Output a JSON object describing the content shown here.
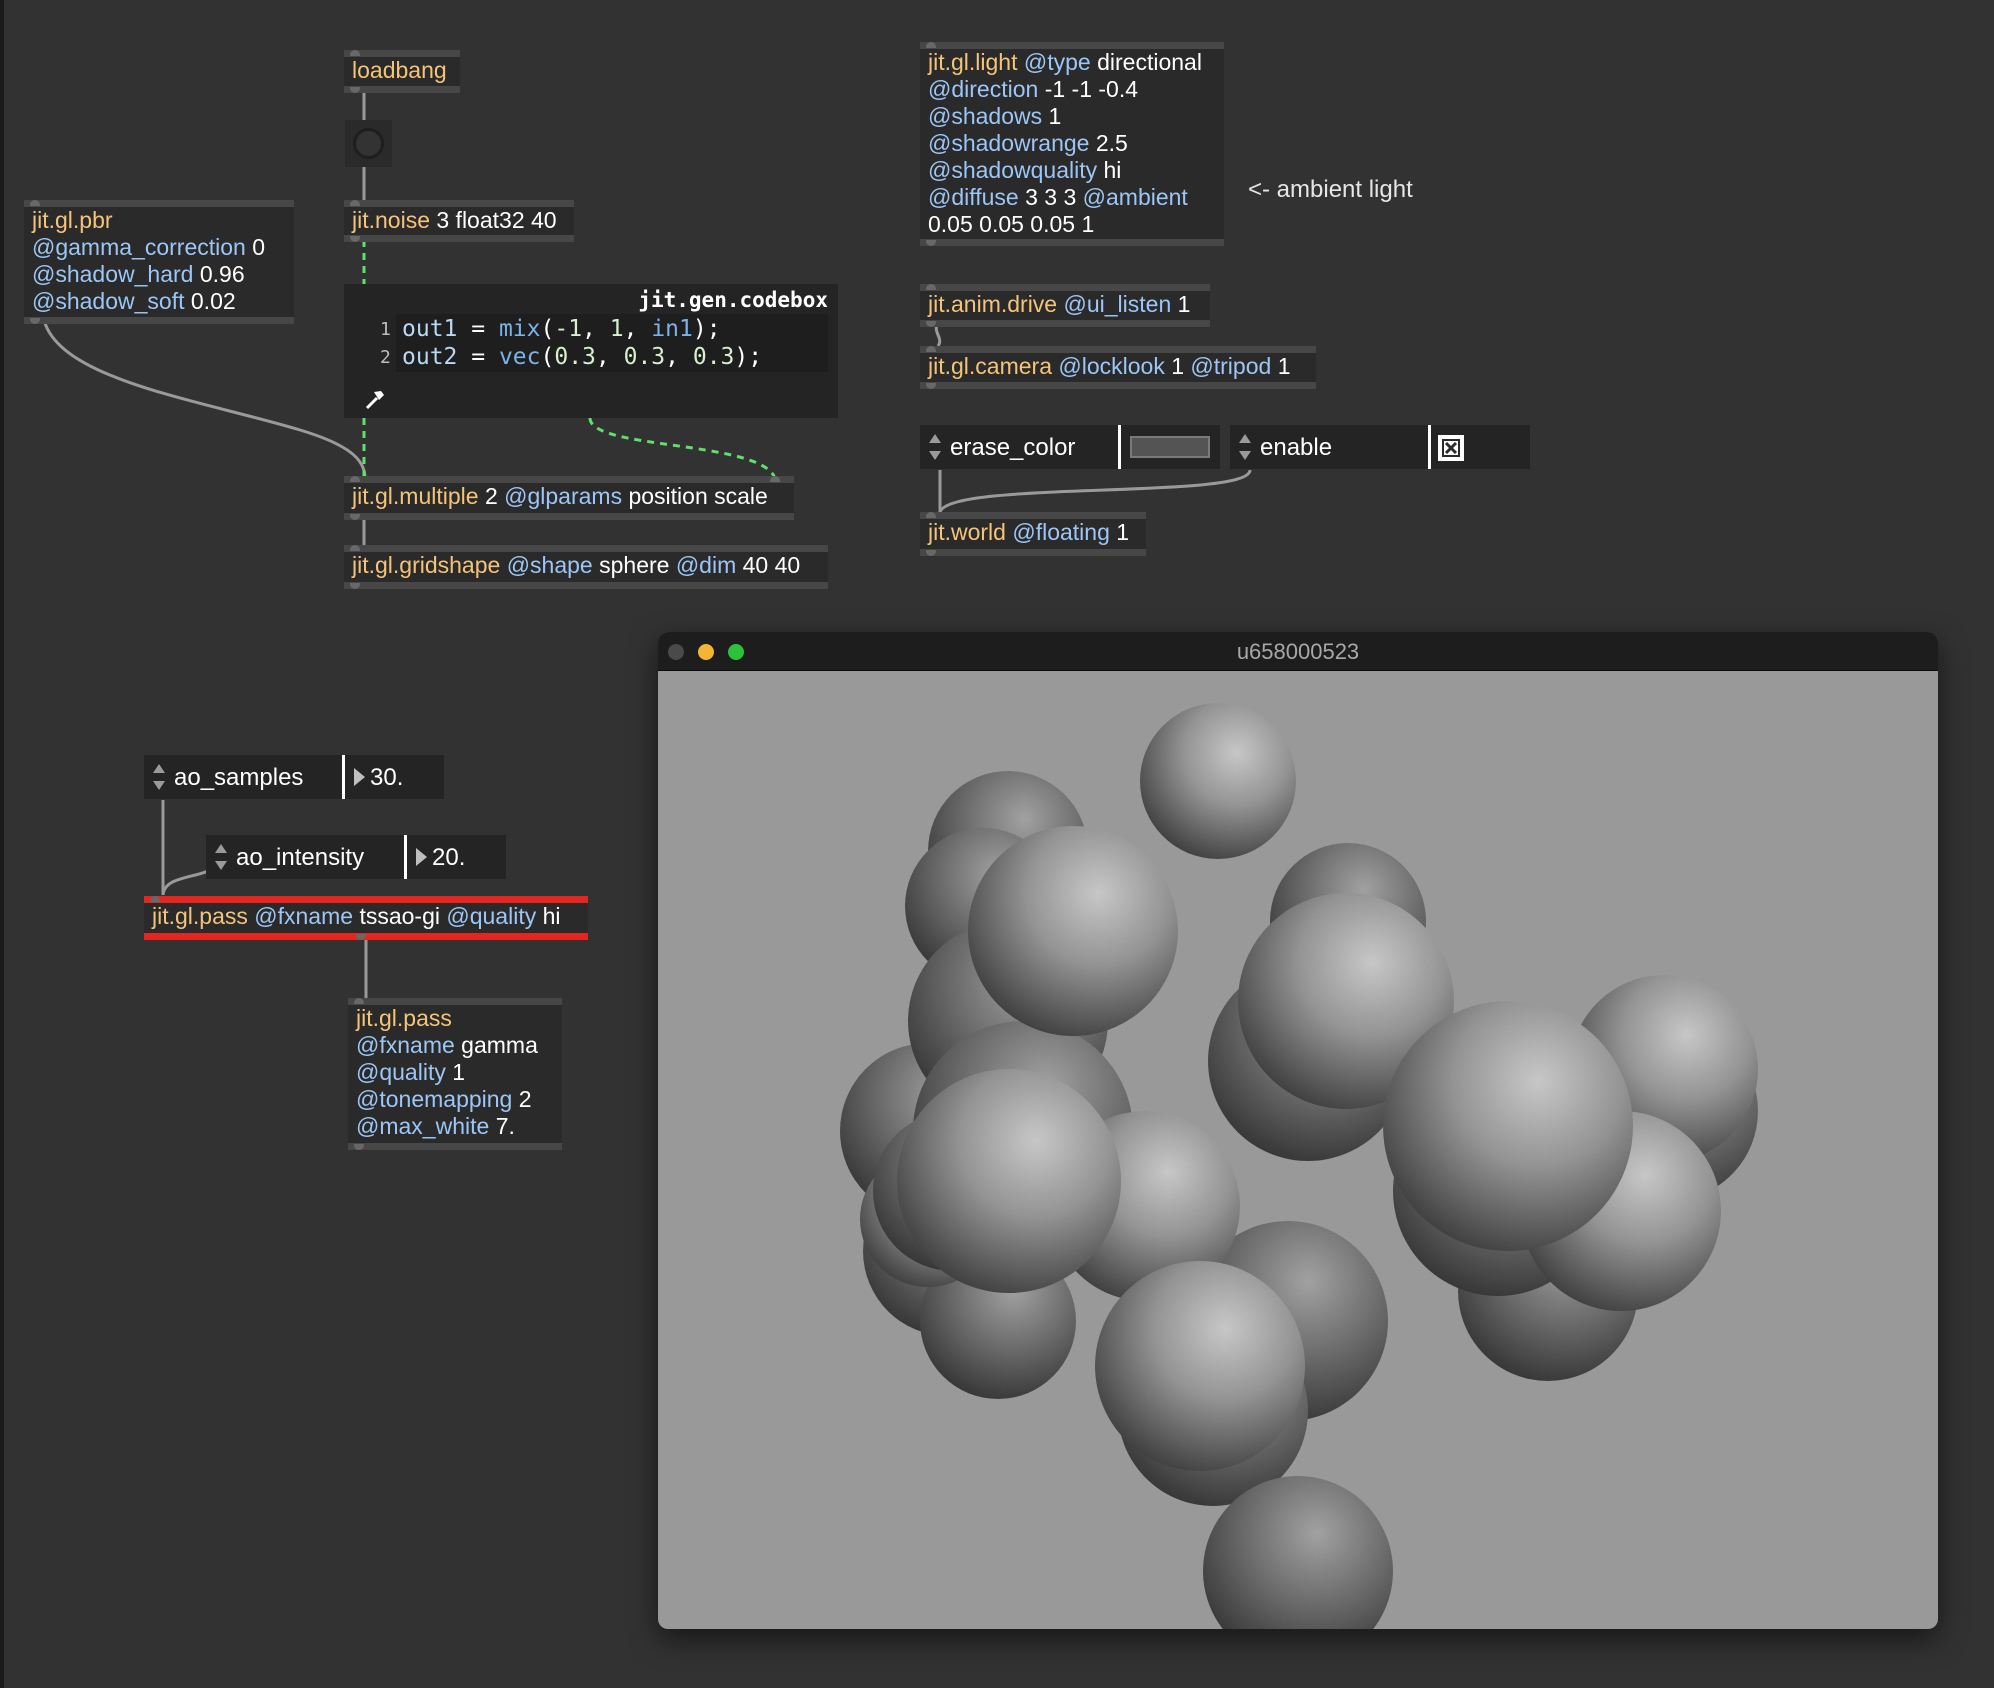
{
  "objects": {
    "loadbang": {
      "name": "loadbang"
    },
    "noise": {
      "name": "jit.noise",
      "args": "3 float32 40"
    },
    "pbr": {
      "name": "jit.gl.pbr",
      "a1": "@gamma_correction",
      "v1": "0",
      "a2": "@shadow_hard",
      "v2": "0.96",
      "a3": "@shadow_soft",
      "v3": "0.02"
    },
    "codebox": {
      "title": "jit.gen.codebox",
      "line_numbers": [
        "1",
        "2"
      ],
      "l1_out": "out1",
      "l1_eq": " = ",
      "l1_fn": "mix",
      "l1_open": "(",
      "l1_a": "-1",
      "l1_c1": ", ",
      "l1_b": "1",
      "l1_c2": ", ",
      "l1_in": "in1",
      "l1_close": ");",
      "l2_out": "out2",
      "l2_eq": " = ",
      "l2_fn": "vec",
      "l2_open": "(",
      "l2_a": "0.3",
      "l2_c1": ", ",
      "l2_b": "0.3",
      "l2_c2": ", ",
      "l2_c": "0.3",
      "l2_close": ");"
    },
    "multiple": {
      "name": "jit.gl.multiple",
      "arg": "2",
      "attr": "@glparams",
      "val": "position scale"
    },
    "gridshape": {
      "name": "jit.gl.gridshape",
      "a1": "@shape",
      "v1": "sphere",
      "a2": "@dim",
      "v2": "40 40"
    },
    "light": {
      "name": "jit.gl.light",
      "a_type": "@type",
      "v_type": "directional",
      "a_dir": "@direction",
      "v_dir": "-1 -1 -0.4",
      "a_sh": "@shadows",
      "v_sh": "1",
      "a_sr": "@shadowrange",
      "v_sr": "2.5",
      "a_sq": "@shadowquality",
      "v_sq": "hi",
      "a_df": "@diffuse",
      "v_df": "3 3 3",
      "a_am": "@ambient",
      "v_am": "0.05 0.05 0.05 1"
    },
    "anim": {
      "name": "jit.anim.drive",
      "attr": "@ui_listen",
      "val": "1"
    },
    "camera": {
      "name": "jit.gl.camera",
      "a1": "@locklook",
      "v1": "1",
      "a2": "@tripod",
      "v2": "1"
    },
    "world": {
      "name": "jit.world",
      "attr": "@floating",
      "val": "1"
    },
    "pass_ao": {
      "name": "jit.gl.pass",
      "a1": "@fxname",
      "v1": "tssao-gi",
      "a2": "@quality",
      "v2": "hi"
    },
    "pass_gamma": {
      "name": "jit.gl.pass",
      "a1": "@fxname",
      "v1": "gamma",
      "a2": "@quality",
      "v2": "1",
      "a3": "@tonemapping",
      "v3": "2",
      "a4": "@max_white",
      "v4": "7."
    }
  },
  "attrui": {
    "erase_color": {
      "label": "erase_color"
    },
    "enable": {
      "label": "enable",
      "checked": true
    },
    "ao_samples": {
      "label": "ao_samples",
      "value": "30."
    },
    "ao_intensity": {
      "label": "ao_intensity",
      "value": "20."
    }
  },
  "comment_ambient": "<- ambient light",
  "window": {
    "title": "u658000523"
  },
  "colors": {
    "patch_bg": "#323232",
    "object_name": "#f4c47a",
    "attribute": "#9cc6f6",
    "selected_border": "#e3261f",
    "cord_signal": "#5ee06a",
    "render_bg": "#999999"
  }
}
